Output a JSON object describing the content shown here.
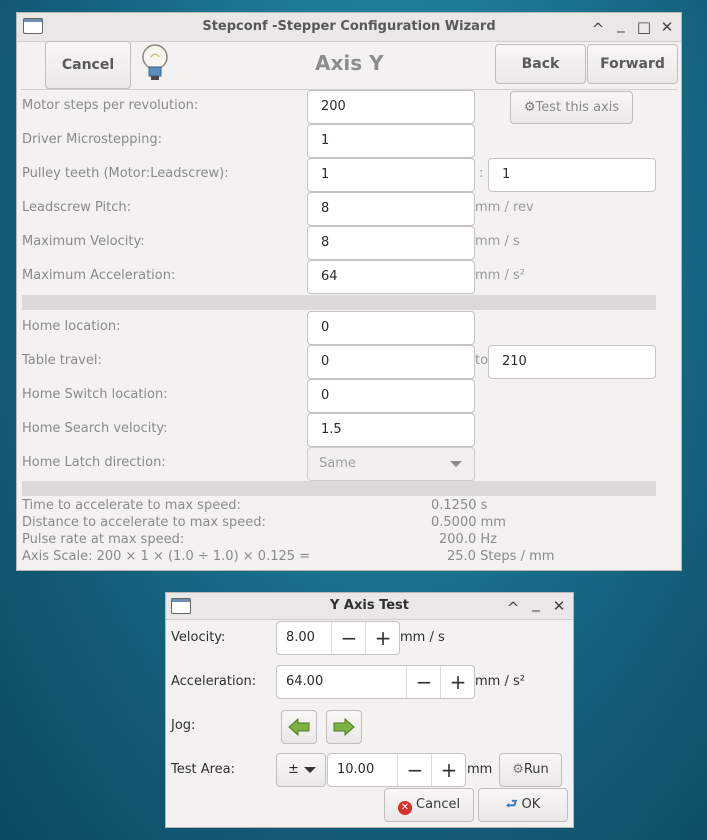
{
  "main": {
    "title": "Stepconf -Stepper Configuration Wizard",
    "cancel": "Cancel",
    "back": "Back",
    "forward": "Forward",
    "page_title": "Axis Y",
    "test_axis": "Test this axis",
    "fields": {
      "steps_label": "Motor steps per revolution:",
      "steps_value": "200",
      "micro_label": "Driver Microstepping:",
      "micro_value": "1",
      "pulley_label": "Pulley teeth (Motor:Leadscrew):",
      "pulley_motor": "1",
      "pulley_colon": ":",
      "pulley_lead": "1",
      "pitch_label": "Leadscrew Pitch:",
      "pitch_value": "8",
      "pitch_unit": "mm / rev",
      "vel_label": "Maximum Velocity:",
      "vel_value": "8",
      "vel_unit": "mm / s",
      "acc_label": "Maximum Acceleration:",
      "acc_value": "64",
      "acc_unit": "mm / s²",
      "home_label": "Home location:",
      "home_value": "0",
      "travel_label": "Table travel:",
      "travel_from": "0",
      "travel_to_label": "to",
      "travel_to": "210",
      "switch_label": "Home Switch location:",
      "switch_value": "0",
      "search_label": "Home Search velocity:",
      "search_value": "1.5",
      "latch_label": "Home Latch direction:",
      "latch_value": "Same"
    },
    "info": {
      "time_label": "Time to accelerate to max speed:",
      "time_value": "0.1250 s",
      "dist_label": "Distance to accelerate to max speed:",
      "dist_value": "0.5000 mm",
      "pulse_label": "Pulse rate at max speed:",
      "pulse_value": "200.0 Hz",
      "scale_label": "Axis Scale: 200 × 1 × (1.0 ÷ 1.0) × 0.125 =",
      "scale_value": "25.0 Steps / mm"
    }
  },
  "test": {
    "title": "Y Axis Test",
    "velocity_label": "Velocity:",
    "velocity_value": "8.00",
    "velocity_unit": "mm / s",
    "accel_label": "Acceleration:",
    "accel_value": "64.00",
    "accel_unit": "mm / s²",
    "jog_label": "Jog:",
    "area_label": "Test Area:",
    "area_mode": "±",
    "area_value": "10.00",
    "area_unit": "mm",
    "run": "Run",
    "cancel": "Cancel",
    "ok": "OK"
  },
  "glyphs": {
    "minus": "−",
    "plus": "+",
    "chevron_up": "^",
    "minimize": "_",
    "maximize": "□",
    "close": "✕"
  }
}
